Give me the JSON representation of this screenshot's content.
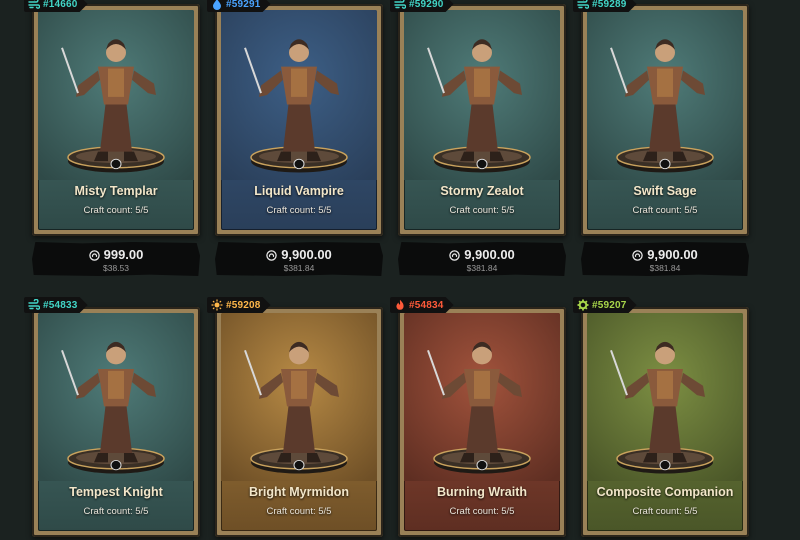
{
  "cards": [
    {
      "id": "#14660",
      "name": "Misty Templar",
      "craft": "Craft count: 5/5",
      "price": "999.00",
      "usd": "$38.53",
      "tag_color": "#42d6c8",
      "tag_icon": "wind-icon",
      "bg_top": "#4f7b78",
      "bg_bottom": "#2f4a48"
    },
    {
      "id": "#59291",
      "name": "Liquid Vampire",
      "craft": "Craft count: 5/5",
      "price": "9,900.00",
      "usd": "$381.84",
      "tag_color": "#4aa3ff",
      "tag_icon": "water-icon",
      "bg_top": "#3d5f86",
      "bg_bottom": "#2a3f5a"
    },
    {
      "id": "#59290",
      "name": "Stormy Zealot",
      "craft": "Craft count: 5/5",
      "price": "9,900.00",
      "usd": "$381.84",
      "tag_color": "#42d6c8",
      "tag_icon": "wind-icon",
      "bg_top": "#4f7b78",
      "bg_bottom": "#2f4a48"
    },
    {
      "id": "#59289",
      "name": "Swift Sage",
      "craft": "Craft count: 5/5",
      "price": "9,900.00",
      "usd": "$381.84",
      "tag_color": "#42d6c8",
      "tag_icon": "wind-icon",
      "bg_top": "#4f7b78",
      "bg_bottom": "#2f4a48"
    },
    {
      "id": "#54833",
      "name": "Tempest Knight",
      "craft": "Craft count: 5/5",
      "price": "",
      "usd": "",
      "tag_color": "#42d6c8",
      "tag_icon": "wind-icon",
      "bg_top": "#4f7b78",
      "bg_bottom": "#2f4a48"
    },
    {
      "id": "#59208",
      "name": "Bright Myrmidon",
      "craft": "Craft count: 5/5",
      "price": "",
      "usd": "",
      "tag_color": "#ffb84a",
      "tag_icon": "sun-icon",
      "bg_top": "#b78a45",
      "bg_bottom": "#6e4f26"
    },
    {
      "id": "#54834",
      "name": "Burning Wraith",
      "craft": "Craft count: 5/5",
      "price": "",
      "usd": "",
      "tag_color": "#ff5a3a",
      "tag_icon": "fire-icon",
      "bg_top": "#a2533c",
      "bg_bottom": "#5e2e22"
    },
    {
      "id": "#59207",
      "name": "Composite Companion",
      "craft": "Craft count: 5/5",
      "price": "",
      "usd": "",
      "tag_color": "#a8d64a",
      "tag_icon": "gear-icon",
      "bg_top": "#7d8f43",
      "bg_bottom": "#4a5628"
    }
  ]
}
